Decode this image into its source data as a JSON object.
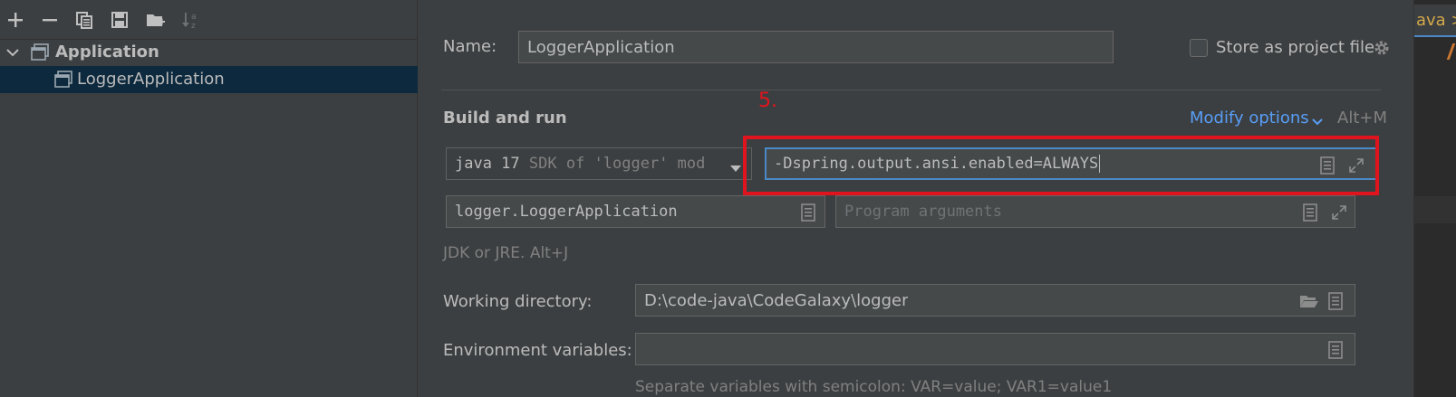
{
  "toolbar": {
    "icons": [
      "add-icon",
      "remove-icon",
      "copy-icon",
      "save-icon",
      "new-folder-icon",
      "sort-icon"
    ]
  },
  "tree": {
    "group_label": "Application",
    "item_label": "LoggerApplication"
  },
  "form": {
    "name_label": "Name:",
    "name_value": "LoggerApplication",
    "store_label": "Store as project file",
    "section_title": "Build and run",
    "modify_options": "Modify options",
    "modify_shortcut": "Alt+M",
    "jdk_main": "java 17",
    "jdk_detail": "SDK of 'logger' mod",
    "vm_options_value": "-Dspring.output.ansi.enabled=ALWAYS",
    "main_class_value": "logger.LoggerApplication",
    "program_args_placeholder": "Program arguments",
    "jdk_hint": "JDK or JRE. Alt+J",
    "workdir_label": "Working directory:",
    "workdir_value": "D:\\code-java\\CodeGalaxy\\logger",
    "env_label": "Environment variables:",
    "env_value": "",
    "env_hint": "Separate variables with semicolon: VAR=value; VAR1=value1"
  },
  "annotation": {
    "step_number": "5.",
    "color": "#e0141e"
  },
  "editor_tab": {
    "label": "ava >"
  },
  "colors": {
    "background": "#3c3f41",
    "selection": "#0d293e",
    "link": "#589df6",
    "text": "#bbbbbb",
    "focus_border": "#4a88c7"
  }
}
